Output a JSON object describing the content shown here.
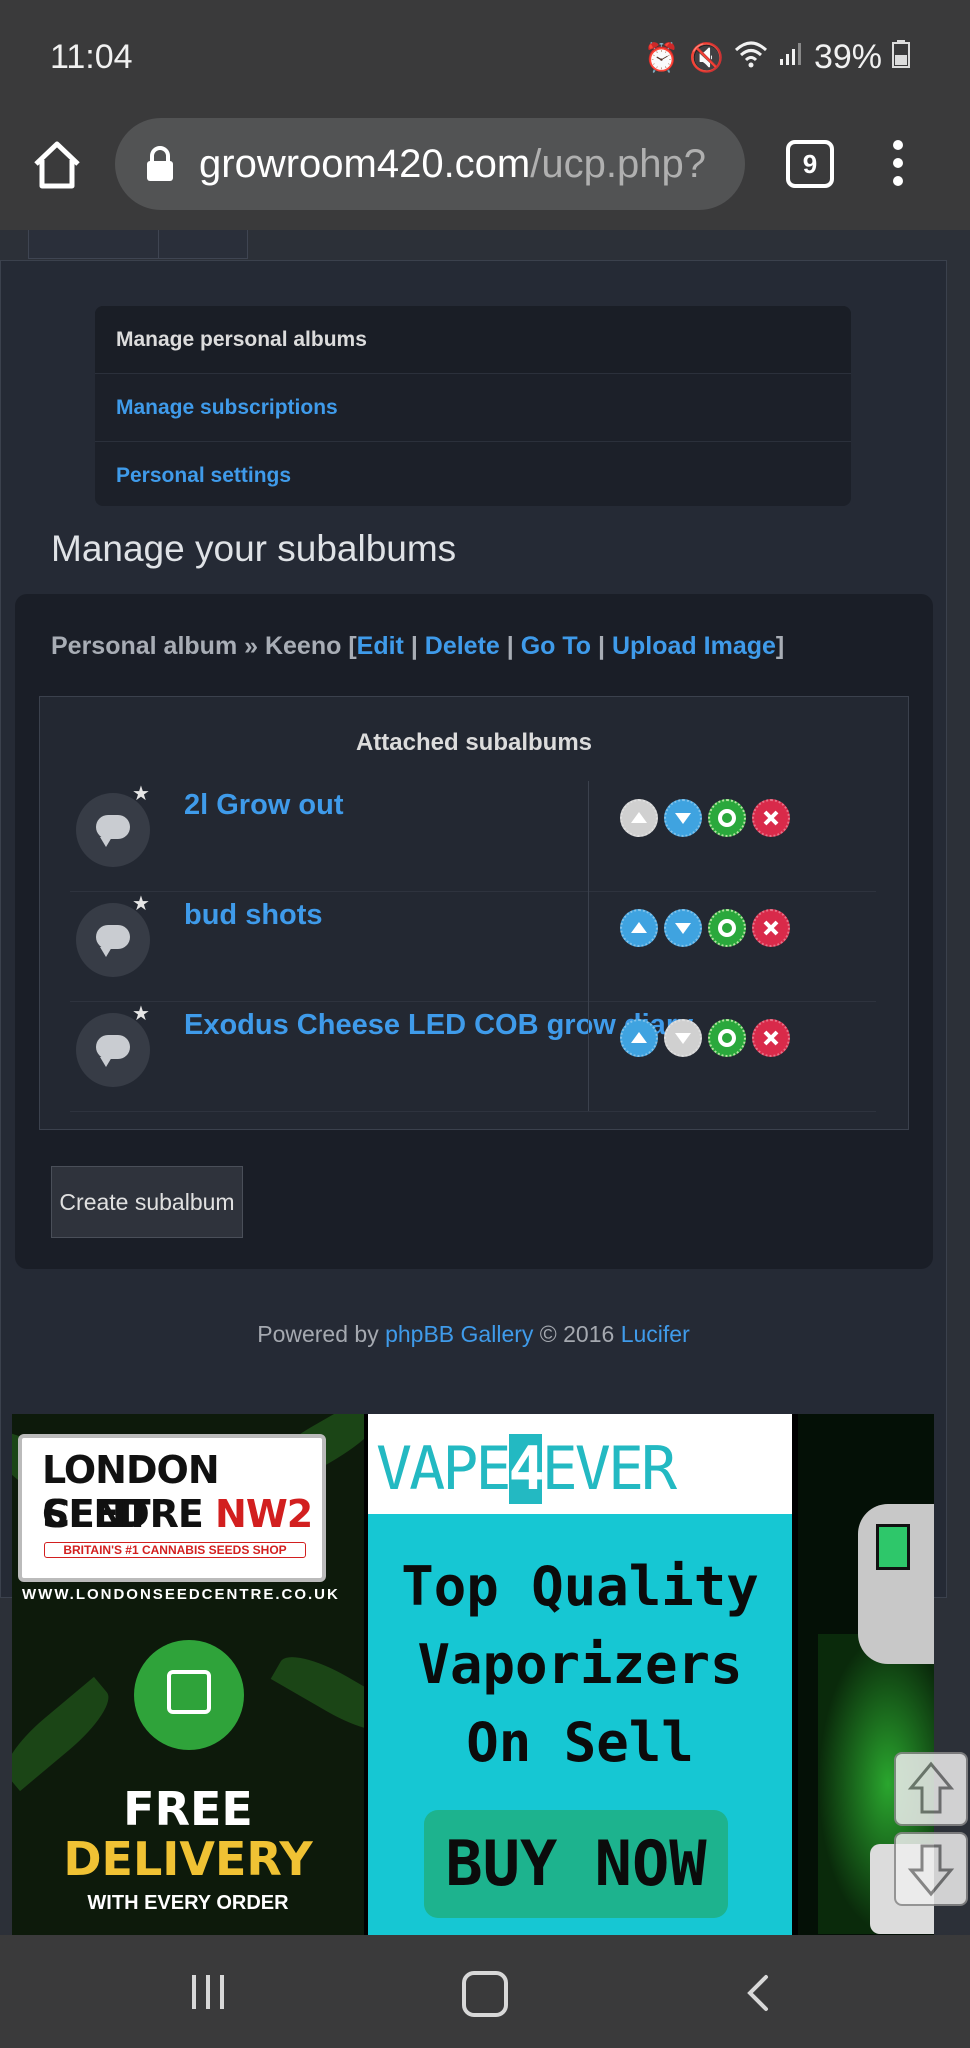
{
  "status": {
    "time": "11:04",
    "battery": "39%"
  },
  "browser": {
    "url_main": "growroom420.com",
    "url_rest": "/ucp.php?",
    "tab_count": "9"
  },
  "submenu": [
    {
      "label": "Manage personal albums",
      "active": true
    },
    {
      "label": "Manage subscriptions"
    },
    {
      "label": "Personal settings"
    }
  ],
  "heading": "Manage your subalbums",
  "breadcrumb": {
    "text": "Personal album » Keeno [",
    "edit": "Edit",
    "delete": "Delete",
    "goto": "Go To",
    "upload": "Upload Image",
    "sep": "|",
    "close": "]"
  },
  "attached": {
    "title": "Attached subalbums",
    "rows": [
      {
        "name": "2l Grow out"
      },
      {
        "name": "bud shots"
      },
      {
        "name": "Exodus Cheese LED COB grow diary"
      }
    ]
  },
  "create_button": "Create subalbum",
  "footer": {
    "prefix": "Powered by ",
    "link1": "phpBB Gallery",
    "mid": " © 2016 ",
    "link2": "Lucifer"
  },
  "ads": {
    "ad1": {
      "line1": "LONDON SEED",
      "line2a": "CENTRE ",
      "line2b": "NW2",
      "tagline": "BRITAIN'S #1 CANNABIS SEEDS SHOP",
      "website": "WWW.LONDONSEEDCENTRE.CO.UK",
      "free": "FREE",
      "delivery": "DELIVERY",
      "every": "WITH EVERY ORDER"
    },
    "ad2": {
      "logo_a": "VAPE",
      "logo_b": "4",
      "logo_c": "EVER",
      "line1": "Top Quality",
      "line2": "Vaporizers",
      "line3": "On Sell",
      "cta": "BUY NOW"
    }
  }
}
